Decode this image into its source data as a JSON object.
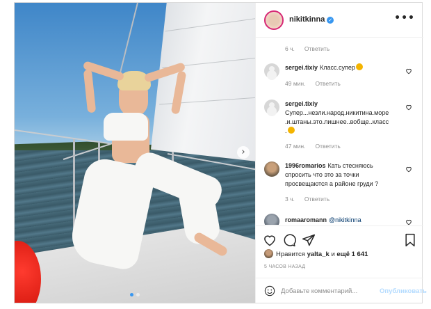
{
  "post": {
    "author": "nikitkinna",
    "menu_icon": "more-horizontal-icon",
    "first_comment_meta": {
      "time": "6 ч.",
      "reply": "Ответить"
    }
  },
  "comments": [
    {
      "user": "sergei.tixiy",
      "text": "Класс.супер",
      "time": "49 мин.",
      "reply": "Ответить",
      "emoji": "clapping-hands-icon"
    },
    {
      "user": "sergei.tixiy",
      "text": "Супер...незли.народ.никитина.море.и.штаны.это.лишнее..вобще..класс.",
      "time": "47 мин.",
      "reply": "Ответить",
      "emoji": "clapping-hands-icon"
    },
    {
      "user": "1996romarios",
      "text": "Кать стесняюсь спросить что это за точки просвещаются а районе груди ?",
      "time": "3 ч.",
      "reply": "Ответить"
    },
    {
      "user": "romaaromann",
      "mention": "@nikitkinna"
    }
  ],
  "likes": {
    "prefix": "Нравится",
    "user": "yalta_k",
    "middle": "и",
    "count_text": "ещё 1 641"
  },
  "time_ago": "5 ЧАСОВ НАЗАД",
  "comment_box": {
    "placeholder": "Добавьте комментарий...",
    "post_label": "Опубликовать"
  },
  "carousel": {
    "slides": 2,
    "active": 0
  },
  "colors": {
    "link": "#00376b",
    "verified": "#3897f0",
    "muted": "#8e8e8e",
    "post_disabled": "#b3dbff"
  }
}
